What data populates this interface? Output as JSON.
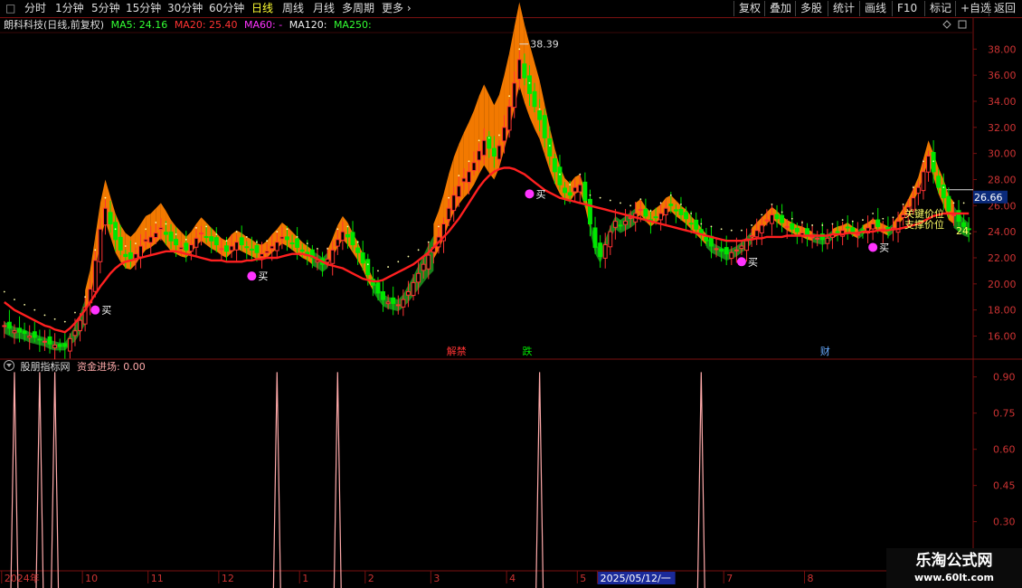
{
  "toolbar": {
    "window_button": "□",
    "periods": [
      "分时",
      "1分钟",
      "5分钟",
      "15分钟",
      "30分钟",
      "60分钟",
      "日线",
      "周线",
      "月线",
      "多周期",
      "更多"
    ],
    "active_period": "日线",
    "more_chevron": "chevron-right-icon",
    "right_buttons": [
      "复权",
      "叠加",
      "多股",
      "统计",
      "画线",
      "F10",
      "标记",
      "+自选",
      "返回"
    ]
  },
  "price_header": {
    "stock": "朗科科技(日线,前复权)",
    "ma5": "MA5: 24.16",
    "ma20": "MA20: 25.40",
    "ma60": "MA60: -",
    "ma120": "MA120:",
    "ma250": "MA250:"
  },
  "indicator_header": {
    "name": "股朋指标网",
    "line": "资金进场: 0.00"
  },
  "colors": {
    "up": "#ff3333",
    "down": "#00e600",
    "orange_band": "#ff7f00",
    "green_band": "#1a8a1a",
    "ma_red": "#ff2020",
    "signal_magenta": "#ff33ff",
    "grid": "#7a1010",
    "axis_text": "#cc3333",
    "indicator": "#ffaaaa"
  },
  "chart_data": [
    {
      "type": "candlestick",
      "ylim": [
        14.3,
        39.2
      ],
      "y_ticks": [
        "38.00",
        "36.00",
        "34.00",
        "32.00",
        "30.00",
        "28.00",
        "26.00",
        "24.00",
        "22.00",
        "20.00",
        "18.00",
        "16.00"
      ],
      "y_tick_values": [
        38,
        36,
        34,
        32,
        30,
        28,
        26,
        24,
        22,
        20,
        18,
        16
      ],
      "current_price_label": "26.66",
      "current_price": 26.66,
      "high_annotation": "38.39",
      "high_value": 38.39,
      "close": [
        16.8,
        16.6,
        16.4,
        16.3,
        16.2,
        16.0,
        15.9,
        15.7,
        15.6,
        15.4,
        15.3,
        15.2,
        15.2,
        15.8,
        16.4,
        17.2,
        18.2,
        19.6,
        21.8,
        24.2,
        25.8,
        24.6,
        23.4,
        22.6,
        22.1,
        21.9,
        22.3,
        22.9,
        23.4,
        23.6,
        23.9,
        24.3,
        23.8,
        23.3,
        23.0,
        22.8,
        22.6,
        23.0,
        23.5,
        23.9,
        23.6,
        23.3,
        23.0,
        22.7,
        22.5,
        22.9,
        23.2,
        23.0,
        22.8,
        22.6,
        22.4,
        22.3,
        22.5,
        22.9,
        23.2,
        23.6,
        23.4,
        23.1,
        22.8,
        22.5,
        22.3,
        22.0,
        21.8,
        21.5,
        21.9,
        22.6,
        23.4,
        24.0,
        23.6,
        23.0,
        22.4,
        21.6,
        20.7,
        19.9,
        19.3,
        18.8,
        18.6,
        18.5,
        18.4,
        18.8,
        19.4,
        20.1,
        20.8,
        21.5,
        22.2,
        22.8,
        23.6,
        24.6,
        25.8,
        26.8,
        27.5,
        28.1,
        28.6,
        29.3,
        30.2,
        31.0,
        30.4,
        29.8,
        30.6,
        32.0,
        33.6,
        35.4,
        37.2,
        35.8,
        34.6,
        33.6,
        32.6,
        31.2,
        29.8,
        28.6,
        27.6,
        27.0,
        26.8,
        27.4,
        27.6,
        26.4,
        24.6,
        22.8,
        22.1,
        23.0,
        24.0,
        24.8,
        24.5,
        24.8,
        25.1,
        25.4,
        25.7,
        25.2,
        24.8,
        25.1,
        25.4,
        25.8,
        26.0,
        25.6,
        25.3,
        25.0,
        24.6,
        24.2,
        23.8,
        23.3,
        22.9,
        22.7,
        22.5,
        22.3,
        22.4,
        22.6,
        22.9,
        23.3,
        23.7,
        24.1,
        24.5,
        24.9,
        25.3,
        25.0,
        24.7,
        24.4,
        24.2,
        24.0,
        23.9,
        23.7,
        23.6,
        23.5,
        23.4,
        23.5,
        23.8,
        24.0,
        24.1,
        24.3,
        24.0,
        23.8,
        24.1,
        24.3,
        24.6,
        24.4,
        24.2,
        24.0,
        24.3,
        24.8,
        25.3,
        25.9,
        26.6,
        27.4,
        28.6,
        29.8,
        28.6,
        27.4,
        26.6,
        25.6,
        25.3,
        24.8,
        24.4,
        24.16
      ],
      "series": [
        {
          "name": "MA20",
          "values": [
            18.6,
            18.3,
            18.0,
            17.8,
            17.6,
            17.4,
            17.2,
            17.0,
            16.8,
            16.7,
            16.5,
            16.4,
            16.3,
            16.6,
            17.0,
            17.5,
            18.0,
            18.6,
            19.2,
            19.8,
            20.3,
            20.8,
            21.2,
            21.5,
            21.7,
            21.8,
            21.9,
            22.0,
            22.1,
            22.2,
            22.3,
            22.4,
            22.5,
            22.5,
            22.5,
            22.4,
            22.3,
            22.2,
            22.1,
            22.0,
            21.9,
            21.8,
            21.8,
            21.8,
            21.7,
            21.7,
            21.7,
            21.7,
            21.8,
            21.8,
            21.9,
            21.9,
            22.0,
            22.0,
            22.0,
            22.1,
            22.2,
            22.3,
            22.3,
            22.3,
            22.2,
            22.1,
            21.9,
            21.7,
            21.5,
            21.4,
            21.3,
            21.2,
            21.0,
            20.8,
            20.6,
            20.4,
            20.3,
            20.2,
            20.2,
            20.3,
            20.5,
            20.7,
            20.9,
            21.1,
            21.3,
            21.5,
            21.8,
            22.1,
            22.4,
            22.8,
            23.2,
            23.6,
            24.0,
            24.5,
            25.0,
            25.6,
            26.2,
            26.8,
            27.4,
            27.9,
            28.3,
            28.6,
            28.8,
            28.9,
            28.9,
            28.8,
            28.6,
            28.4,
            28.1,
            27.8,
            27.5,
            27.2,
            27.0,
            26.8,
            26.6,
            26.5,
            26.4,
            26.3,
            26.2,
            26.1,
            26.0,
            25.9,
            25.8,
            25.7,
            25.6,
            25.5,
            25.4,
            25.3,
            25.2,
            25.1,
            25.0,
            24.9,
            24.8,
            24.7,
            24.6,
            24.5,
            24.4,
            24.3,
            24.2,
            24.1,
            24.0,
            23.9,
            23.8,
            23.7,
            23.6,
            23.5,
            23.4,
            23.3,
            23.3,
            23.3,
            23.3,
            23.4,
            23.4,
            23.5,
            23.5,
            23.6,
            23.6,
            23.6,
            23.6,
            23.7,
            23.7,
            23.7,
            23.7,
            23.7,
            23.7,
            23.7,
            23.7,
            23.7,
            23.8,
            23.8,
            23.8,
            23.9,
            23.9,
            23.9,
            24.0,
            24.0,
            24.0,
            24.1,
            24.1,
            24.1,
            24.2,
            24.2,
            24.3,
            24.4,
            24.5,
            24.6,
            24.8,
            25.0,
            25.2,
            25.3,
            25.4,
            25.4,
            25.4,
            25.4,
            25.4,
            25.4
          ]
        }
      ],
      "band_upper_offset": [
        0.6,
        0.6,
        0.6,
        0.5,
        0.5,
        0.5,
        0.5,
        0.4,
        0.4,
        0.4,
        0.4,
        0.3,
        0.3,
        0.5,
        0.8,
        1.0,
        1.3,
        1.5,
        1.8,
        2.0,
        2.2,
        2.1,
        2.0,
        1.9,
        1.8,
        1.7,
        1.7,
        1.7,
        1.8,
        1.8,
        1.9,
        1.9,
        1.8,
        1.6,
        1.4,
        1.2,
        1.0,
        1.0,
        1.1,
        1.2,
        1.1,
        1.0,
        0.9,
        0.8,
        0.8,
        0.9,
        0.9,
        0.9,
        0.8,
        0.8,
        0.7,
        0.7,
        0.8,
        0.9,
        1.0,
        1.1,
        1.0,
        0.9,
        0.8,
        0.7,
        0.6,
        0.6,
        0.6,
        0.6,
        0.7,
        0.9,
        1.1,
        1.2,
        1.1,
        0.9,
        0.8,
        0.7,
        0.6,
        0.5,
        0.5,
        0.5,
        0.5,
        0.5,
        0.5,
        0.6,
        0.8,
        1.0,
        1.2,
        1.4,
        1.6,
        1.8,
        2.0,
        2.3,
        2.6,
        2.9,
        3.2,
        3.5,
        3.8,
        4.0,
        4.2,
        4.3,
        4.1,
        3.9,
        3.9,
        4.0,
        4.1,
        4.3,
        4.4,
        4.1,
        3.8,
        3.4,
        3.0,
        2.6,
        2.2,
        1.8,
        1.4,
        1.1,
        0.9,
        0.8,
        0.8,
        0.7,
        0.6,
        0.5,
        0.5,
        0.5,
        0.5,
        0.6,
        0.6,
        0.7,
        0.8,
        0.8,
        0.8,
        0.7,
        0.7,
        0.7,
        0.7,
        0.8,
        0.8,
        0.8,
        0.7,
        0.7,
        0.6,
        0.6,
        0.5,
        0.5,
        0.5,
        0.5,
        0.5,
        0.5,
        0.5,
        0.5,
        0.5,
        0.6,
        0.6,
        0.6,
        0.6,
        0.6,
        0.6,
        0.6,
        0.5,
        0.5,
        0.5,
        0.5,
        0.5,
        0.5,
        0.4,
        0.4,
        0.4,
        0.4,
        0.4,
        0.4,
        0.4,
        0.4,
        0.4,
        0.4,
        0.4,
        0.4,
        0.4,
        0.4,
        0.4,
        0.4,
        0.4,
        0.4,
        0.5,
        0.6,
        0.7,
        0.8,
        1.0,
        1.2,
        1.4,
        1.5,
        1.4,
        1.2,
        1.0,
        0.8,
        0.7,
        0.6,
        0.5,
        0.5
      ],
      "band_lower_offset": [
        0.3,
        0.3,
        0.3,
        0.3,
        0.3,
        0.3,
        0.3,
        0.3,
        0.3,
        0.3,
        0.3,
        0.3,
        0.3,
        0.3,
        0.4,
        0.5,
        0.6,
        0.7,
        0.8,
        0.9,
        1.0,
        1.0,
        1.0,
        0.9,
        0.9,
        0.8,
        0.8,
        0.8,
        0.8,
        0.8,
        0.8,
        0.8,
        0.8,
        0.8,
        0.7,
        0.7,
        0.6,
        0.6,
        0.6,
        0.6,
        0.6,
        0.6,
        0.5,
        0.5,
        0.5,
        0.5,
        0.5,
        0.5,
        0.5,
        0.5,
        0.5,
        0.5,
        0.5,
        0.5,
        0.5,
        0.5,
        0.5,
        0.5,
        0.5,
        0.5,
        0.5,
        0.5,
        0.5,
        0.5,
        0.5,
        0.5,
        0.6,
        0.6,
        0.6,
        0.6,
        0.6,
        0.5,
        0.5,
        0.4,
        0.4,
        0.4,
        0.4,
        0.4,
        0.4,
        0.4,
        0.5,
        0.5,
        0.6,
        0.7,
        0.8,
        0.9,
        1.0,
        1.1,
        1.2,
        1.3,
        1.4,
        1.5,
        1.6,
        1.7,
        1.8,
        1.9,
        1.9,
        1.8,
        1.7,
        1.7,
        1.8,
        1.9,
        2.0,
        1.9,
        1.8,
        1.7,
        1.5,
        1.3,
        1.1,
        0.9,
        0.7,
        0.6,
        0.5,
        0.5,
        0.5,
        0.5,
        0.4,
        0.4,
        0.4,
        0.4,
        0.4,
        0.4,
        0.4,
        0.4,
        0.4,
        0.4,
        0.4,
        0.4,
        0.4,
        0.4,
        0.4,
        0.4,
        0.4,
        0.4,
        0.4,
        0.4,
        0.4,
        0.4,
        0.4,
        0.3,
        0.3,
        0.3,
        0.3,
        0.3,
        0.3,
        0.3,
        0.3,
        0.3,
        0.3,
        0.3,
        0.3,
        0.3,
        0.3,
        0.3,
        0.3,
        0.3,
        0.3,
        0.3,
        0.3,
        0.3,
        0.3,
        0.3,
        0.3,
        0.3,
        0.3,
        0.3,
        0.3,
        0.3,
        0.3,
        0.3,
        0.3,
        0.3,
        0.3,
        0.3,
        0.3,
        0.3,
        0.3,
        0.3,
        0.3,
        0.3,
        0.3,
        0.3,
        0.3,
        0.4,
        0.4,
        0.5,
        0.6,
        0.7,
        0.7,
        0.6,
        0.6,
        0.5,
        0.5,
        0.4,
        0.4,
        0.4
      ],
      "buy_signal_bars": [
        18,
        49,
        104,
        146,
        172
      ],
      "buy_label": "买",
      "marker_labels": [
        "解禁",
        "跌",
        "财"
      ],
      "marker_bars": [
        89,
        104,
        163
      ],
      "right_side_labels": [
        "关键价位",
        "支撑价位",
        "24."
      ]
    },
    {
      "type": "line",
      "ylim": [
        0.1,
        0.97
      ],
      "y_ticks": [
        "0.90",
        "0.75",
        "0.60",
        "0.45",
        "0.30",
        "0.15"
      ],
      "y_tick_values": [
        0.9,
        0.75,
        0.6,
        0.45,
        0.3,
        0.15
      ],
      "spike_bars": [
        2,
        7,
        10,
        54,
        66,
        106,
        138
      ],
      "spike_value": 0.92
    }
  ],
  "x_axis": {
    "labels": [
      "2024年",
      "10",
      "11",
      "12",
      "1",
      "2",
      "3",
      "4",
      "5",
      "2025/05/12/一",
      "7",
      "8"
    ],
    "label_bars": [
      0,
      16,
      29,
      43,
      59,
      72,
      85,
      100,
      114,
      118,
      143,
      159
    ],
    "cursor_label": "2025/05/12/一"
  },
  "watermark": {
    "title": "乐淘公式网",
    "url": "www.60lt.com"
  }
}
